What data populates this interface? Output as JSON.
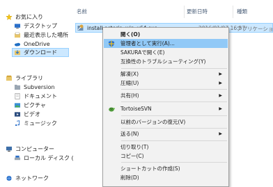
{
  "sidebar": {
    "quick_access": "お気に入り",
    "items": [
      {
        "label": "デスクトップ"
      },
      {
        "label": "最近表示した場所"
      },
      {
        "label": "OneDrive"
      },
      {
        "label": "ダウンロード"
      }
    ],
    "library": "ライブラリ",
    "library_items": [
      {
        "label": "Subversion"
      },
      {
        "label": "ドキュメント"
      },
      {
        "label": "ピクチャ"
      },
      {
        "label": "ビデオ"
      },
      {
        "label": "ミュージック"
      }
    ],
    "computer": "コンピューター",
    "computer_items": [
      {
        "label": "ローカル ディスク ("
      }
    ],
    "network": "ネットワーク"
  },
  "columns": {
    "name": "名前",
    "date": "更新日時",
    "type": "種類"
  },
  "file": {
    "name": "install-astoria_win_x64.exe",
    "date": "2016/01/07 16:57",
    "type": "アプリケーショ"
  },
  "context_menu": {
    "open": "開く(O)",
    "run_as_admin": "管理者として実行(A)...",
    "open_sakura": "SAKURAで開く(E)",
    "troubleshoot": "互換性のトラブルシューティング(Y)",
    "extract": "解凍(X)",
    "compress": "圧縮(U)",
    "share": "共有(H)",
    "tortoise": "TortoiseSVN",
    "restore": "以前のバージョンの復元(V)",
    "send_to": "送る(N)",
    "cut": "切り取り(T)",
    "copy": "コピー(C)",
    "shortcut": "ショートカットの作成(S)",
    "delete": "削除(D)"
  },
  "colors": {
    "selection": "#cce8ff",
    "menu_hover": "#91c9f7",
    "menu_bg": "#f2f2f2"
  }
}
